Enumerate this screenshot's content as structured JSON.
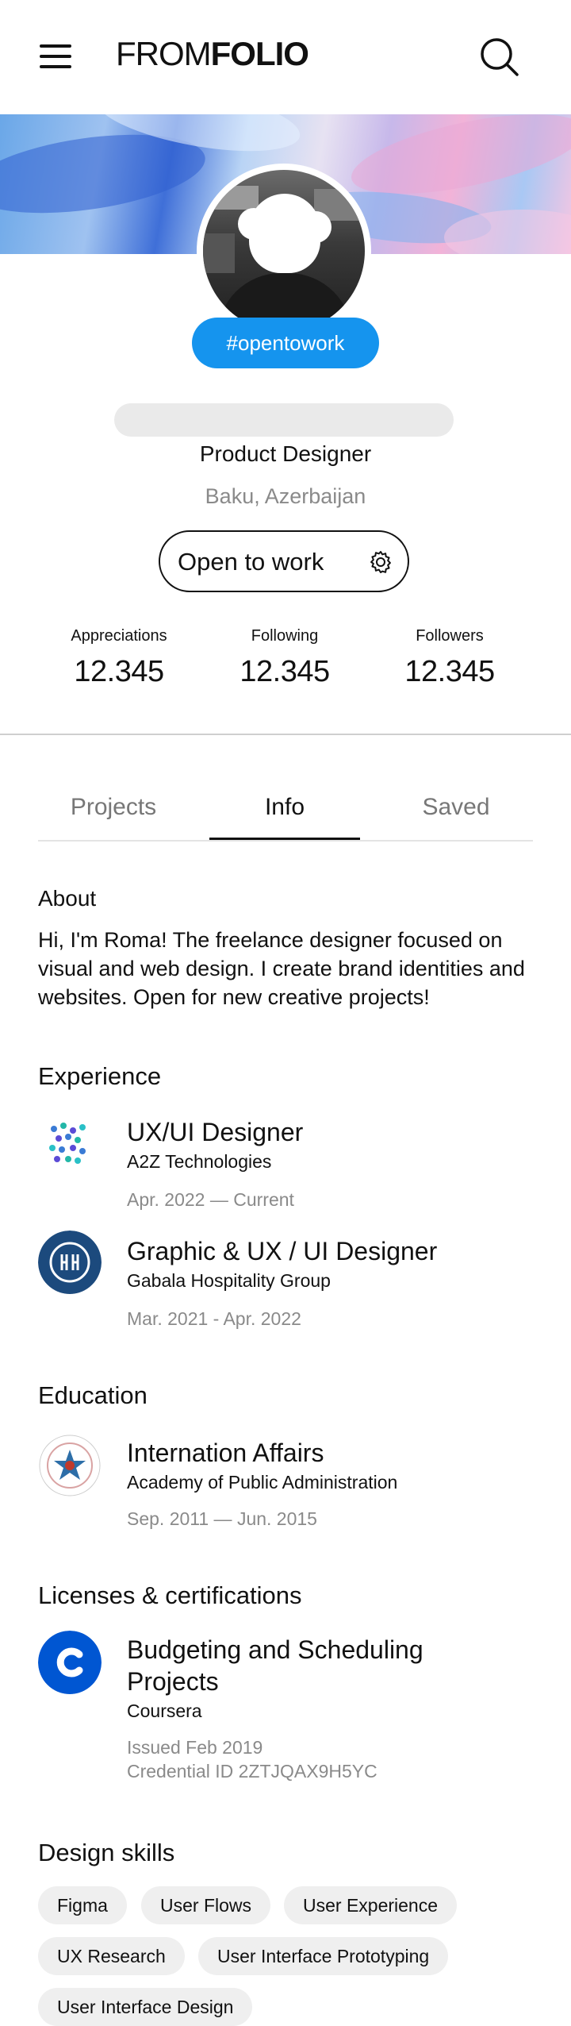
{
  "header": {
    "logo_part1": "FROM",
    "logo_part2": "FOLIO"
  },
  "profile": {
    "badge": "#opentowork",
    "job_title": "Product Designer",
    "location": "Baku, Azerbaijan",
    "open_to_work_label": "Open to work"
  },
  "stats": [
    {
      "label": "Appreciations",
      "value": "12.345"
    },
    {
      "label": "Following",
      "value": "12.345"
    },
    {
      "label": "Followers",
      "value": "12.345"
    }
  ],
  "tabs": [
    {
      "label": "Projects",
      "active": false
    },
    {
      "label": "Info",
      "active": true
    },
    {
      "label": "Saved",
      "active": false
    }
  ],
  "about": {
    "title": "About",
    "text": "Hi, I'm Roma! The freelance designer focused on visual and web design. I create brand identities and websites. Open for new creative projects!"
  },
  "experience": {
    "title": "Experience",
    "items": [
      {
        "role": "UX/UI Designer",
        "company": "A2Z Technologies",
        "period": "Apr. 2022 — Current"
      },
      {
        "role": "Graphic & UX / UI Designer",
        "company": "Gabala Hospitality Group",
        "period": "Mar. 2021 - Apr. 2022"
      }
    ]
  },
  "education": {
    "title": "Education",
    "items": [
      {
        "field": "Internation Affairs",
        "school": "Academy of Public Administration",
        "period": "Sep. 2011 — Jun. 2015"
      }
    ]
  },
  "licenses": {
    "title": "Licenses & certifications",
    "items": [
      {
        "name": "Budgeting and Scheduling Projects",
        "issuer": "Coursera",
        "issued": "Issued Feb 2019",
        "credential": "Credential ID 2ZTJQAX9H5YC"
      }
    ]
  },
  "skills": {
    "title": "Design skills",
    "items": [
      "Figma",
      "User Flows",
      "User Experience",
      "UX Research",
      "User Interface Prototyping",
      "User Interface Design"
    ]
  },
  "colors": {
    "accent": "#1594ee",
    "coursera": "#0056d2",
    "gabala": "#1c4a7d"
  }
}
